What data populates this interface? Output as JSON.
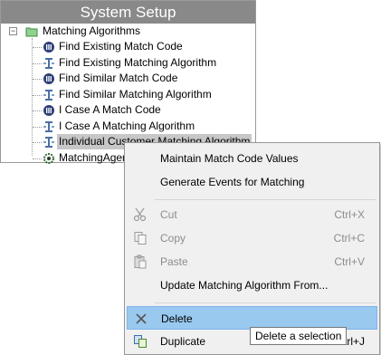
{
  "panel": {
    "title": "System Setup",
    "root": {
      "label": "Matching Algorithms",
      "icon": "folder-icon",
      "expander": "−"
    },
    "items": [
      {
        "label": "Find Existing Match Code",
        "icon": "match-code-icon"
      },
      {
        "label": "Find Existing Matching Algorithm",
        "icon": "matching-algorithm-icon"
      },
      {
        "label": "Find Similar Match Code",
        "icon": "match-code-icon"
      },
      {
        "label": "Find Similar Matching Algorithm",
        "icon": "matching-algorithm-icon"
      },
      {
        "label": "I Case A Match Code",
        "icon": "match-code-icon"
      },
      {
        "label": "I Case A Matching Algorithm",
        "icon": "matching-algorithm-icon"
      },
      {
        "label": "Individual Customer Matching Algorithm",
        "icon": "matching-algorithm-icon",
        "selected": true
      },
      {
        "label": "MatchingAgent",
        "icon": "gear-agent-icon"
      }
    ]
  },
  "menu": {
    "items": [
      {
        "label": "Maintain Match Code Values",
        "shortcut": "",
        "enabled": true
      },
      {
        "label": "Generate Events for Matching",
        "shortcut": "",
        "enabled": true
      },
      {
        "label": "Cut",
        "shortcut": "Ctrl+X",
        "enabled": false,
        "icon": "scissors-icon"
      },
      {
        "label": "Copy",
        "shortcut": "Ctrl+C",
        "enabled": false,
        "icon": "copy-icon"
      },
      {
        "label": "Paste",
        "shortcut": "Ctrl+V",
        "enabled": false,
        "icon": "paste-icon"
      },
      {
        "label": "Update Matching Algorithm From...",
        "shortcut": "",
        "enabled": true
      },
      {
        "label": "Delete",
        "shortcut": "",
        "enabled": true,
        "icon": "delete-x-icon",
        "highlighted": true
      },
      {
        "label": "Duplicate",
        "shortcut": "Ctrl+J",
        "enabled": true,
        "icon": "duplicate-icon"
      }
    ]
  },
  "tooltip": {
    "text": "Delete a selection"
  },
  "colors": {
    "title_bar": "#898989",
    "selected_row": "#c7c7c7",
    "menu_bg": "#f0f0f0",
    "menu_highlight": "#99c9ef",
    "disabled_text": "#8c8c8c"
  }
}
